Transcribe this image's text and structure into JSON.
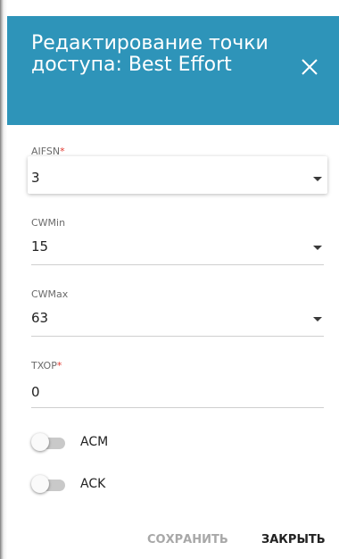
{
  "dialog": {
    "title": "Редактирование точки доступа: Best Effort",
    "close_icon": "close-icon",
    "header_color": "#2e94b9"
  },
  "fields": {
    "aifsn": {
      "label": "AIFSN",
      "required_mark": "*",
      "value": "3"
    },
    "cwmin": {
      "label": "CWMin",
      "value": "15"
    },
    "cwmax": {
      "label": "CWMax",
      "value": "63"
    },
    "txop": {
      "label": "TXOP",
      "required_mark": "*",
      "value": "0"
    }
  },
  "toggles": {
    "acm": {
      "label": "ACM",
      "on": false
    },
    "ack": {
      "label": "ACK",
      "on": false
    }
  },
  "footer": {
    "save_label": "СОХРАНИТЬ",
    "close_label": "ЗАКРЫТЬ"
  }
}
